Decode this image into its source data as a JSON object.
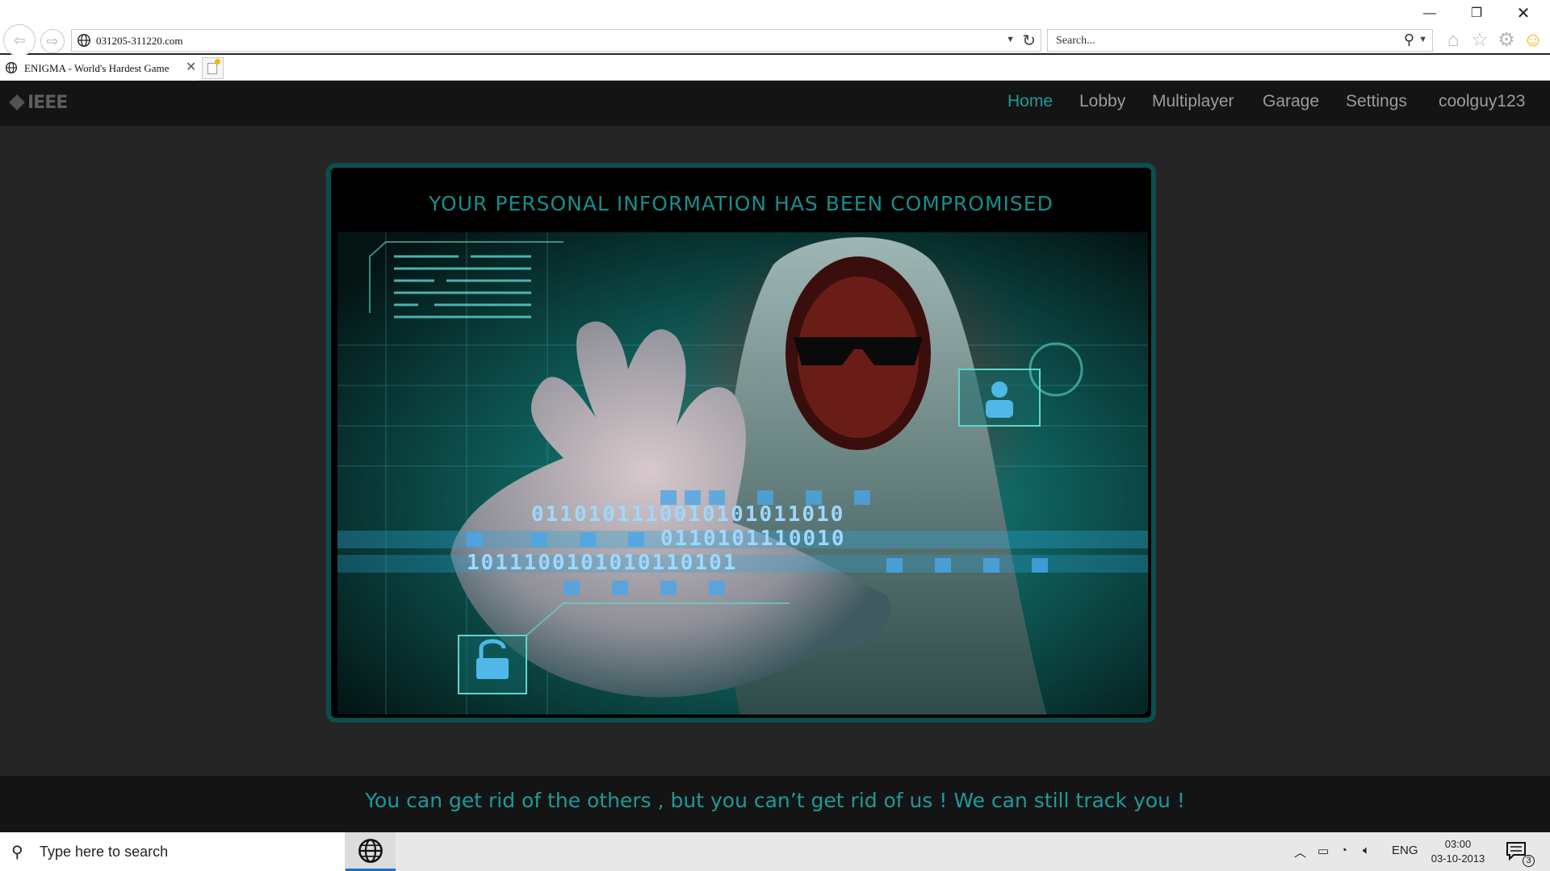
{
  "browser": {
    "address": "031205-311220.com",
    "search_placeholder": "Search...",
    "tab_title": "ENIGMA - World's Hardest Game",
    "toolbar_icons": [
      "home-icon",
      "star-icon",
      "gear-icon",
      "smiley-icon"
    ]
  },
  "site": {
    "nav": [
      "Home",
      "Lobby",
      "Multiplayer",
      "Garage",
      "Settings",
      "coolguy123"
    ],
    "active_nav": "Home",
    "logo_text": "IEEE",
    "headline": "YOUR PERSONAL INFORMATION  HAS BEEN COMPROMISED",
    "footer_message": "You can get rid of the others , but you can’t get rid of us ! We can still track you !",
    "binary_lines": [
      "0110101110010101011010",
      "0110101110010",
      "1011100101010110101"
    ]
  },
  "taskbar": {
    "search_placeholder": "Type here to search",
    "language": "ENG",
    "time": "03:00",
    "date": "03-10-2013",
    "notification_count": "3"
  },
  "colors": {
    "accent": "#1e9a9a",
    "panel_border": "#0b4f4c",
    "nav_bg": "#141414",
    "page_bg": "#252525"
  }
}
